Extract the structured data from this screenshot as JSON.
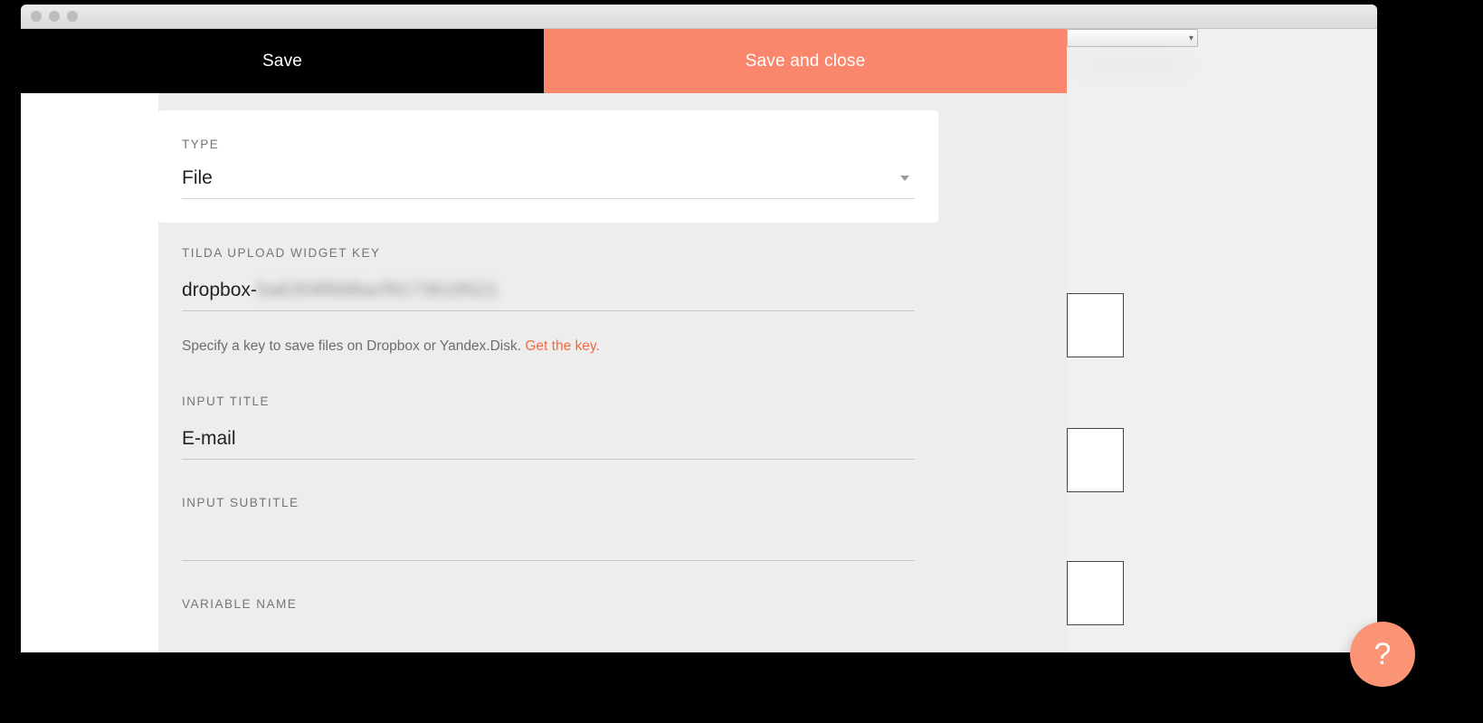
{
  "header": {
    "save_label": "Save",
    "save_close_label": "Save and close"
  },
  "fields": {
    "type": {
      "label": "TYPE",
      "value": "File"
    },
    "upload_key": {
      "label": "TILDA UPLOAD WIDGET KEY",
      "prefix": "dropbox-",
      "masked_suffix": "5a6309f688acf9173618521",
      "hint_text": "Specify a key to save files on Dropbox or Yandex.Disk. ",
      "hint_link": "Get the key."
    },
    "input_title": {
      "label": "INPUT TITLE",
      "value": "E-mail"
    },
    "input_subtitle": {
      "label": "INPUT SUBTITLE",
      "value": ""
    },
    "variable_name": {
      "label": "VARIABLE NAME"
    }
  },
  "help": {
    "glyph": "?"
  },
  "bg_select_caret": "▾"
}
